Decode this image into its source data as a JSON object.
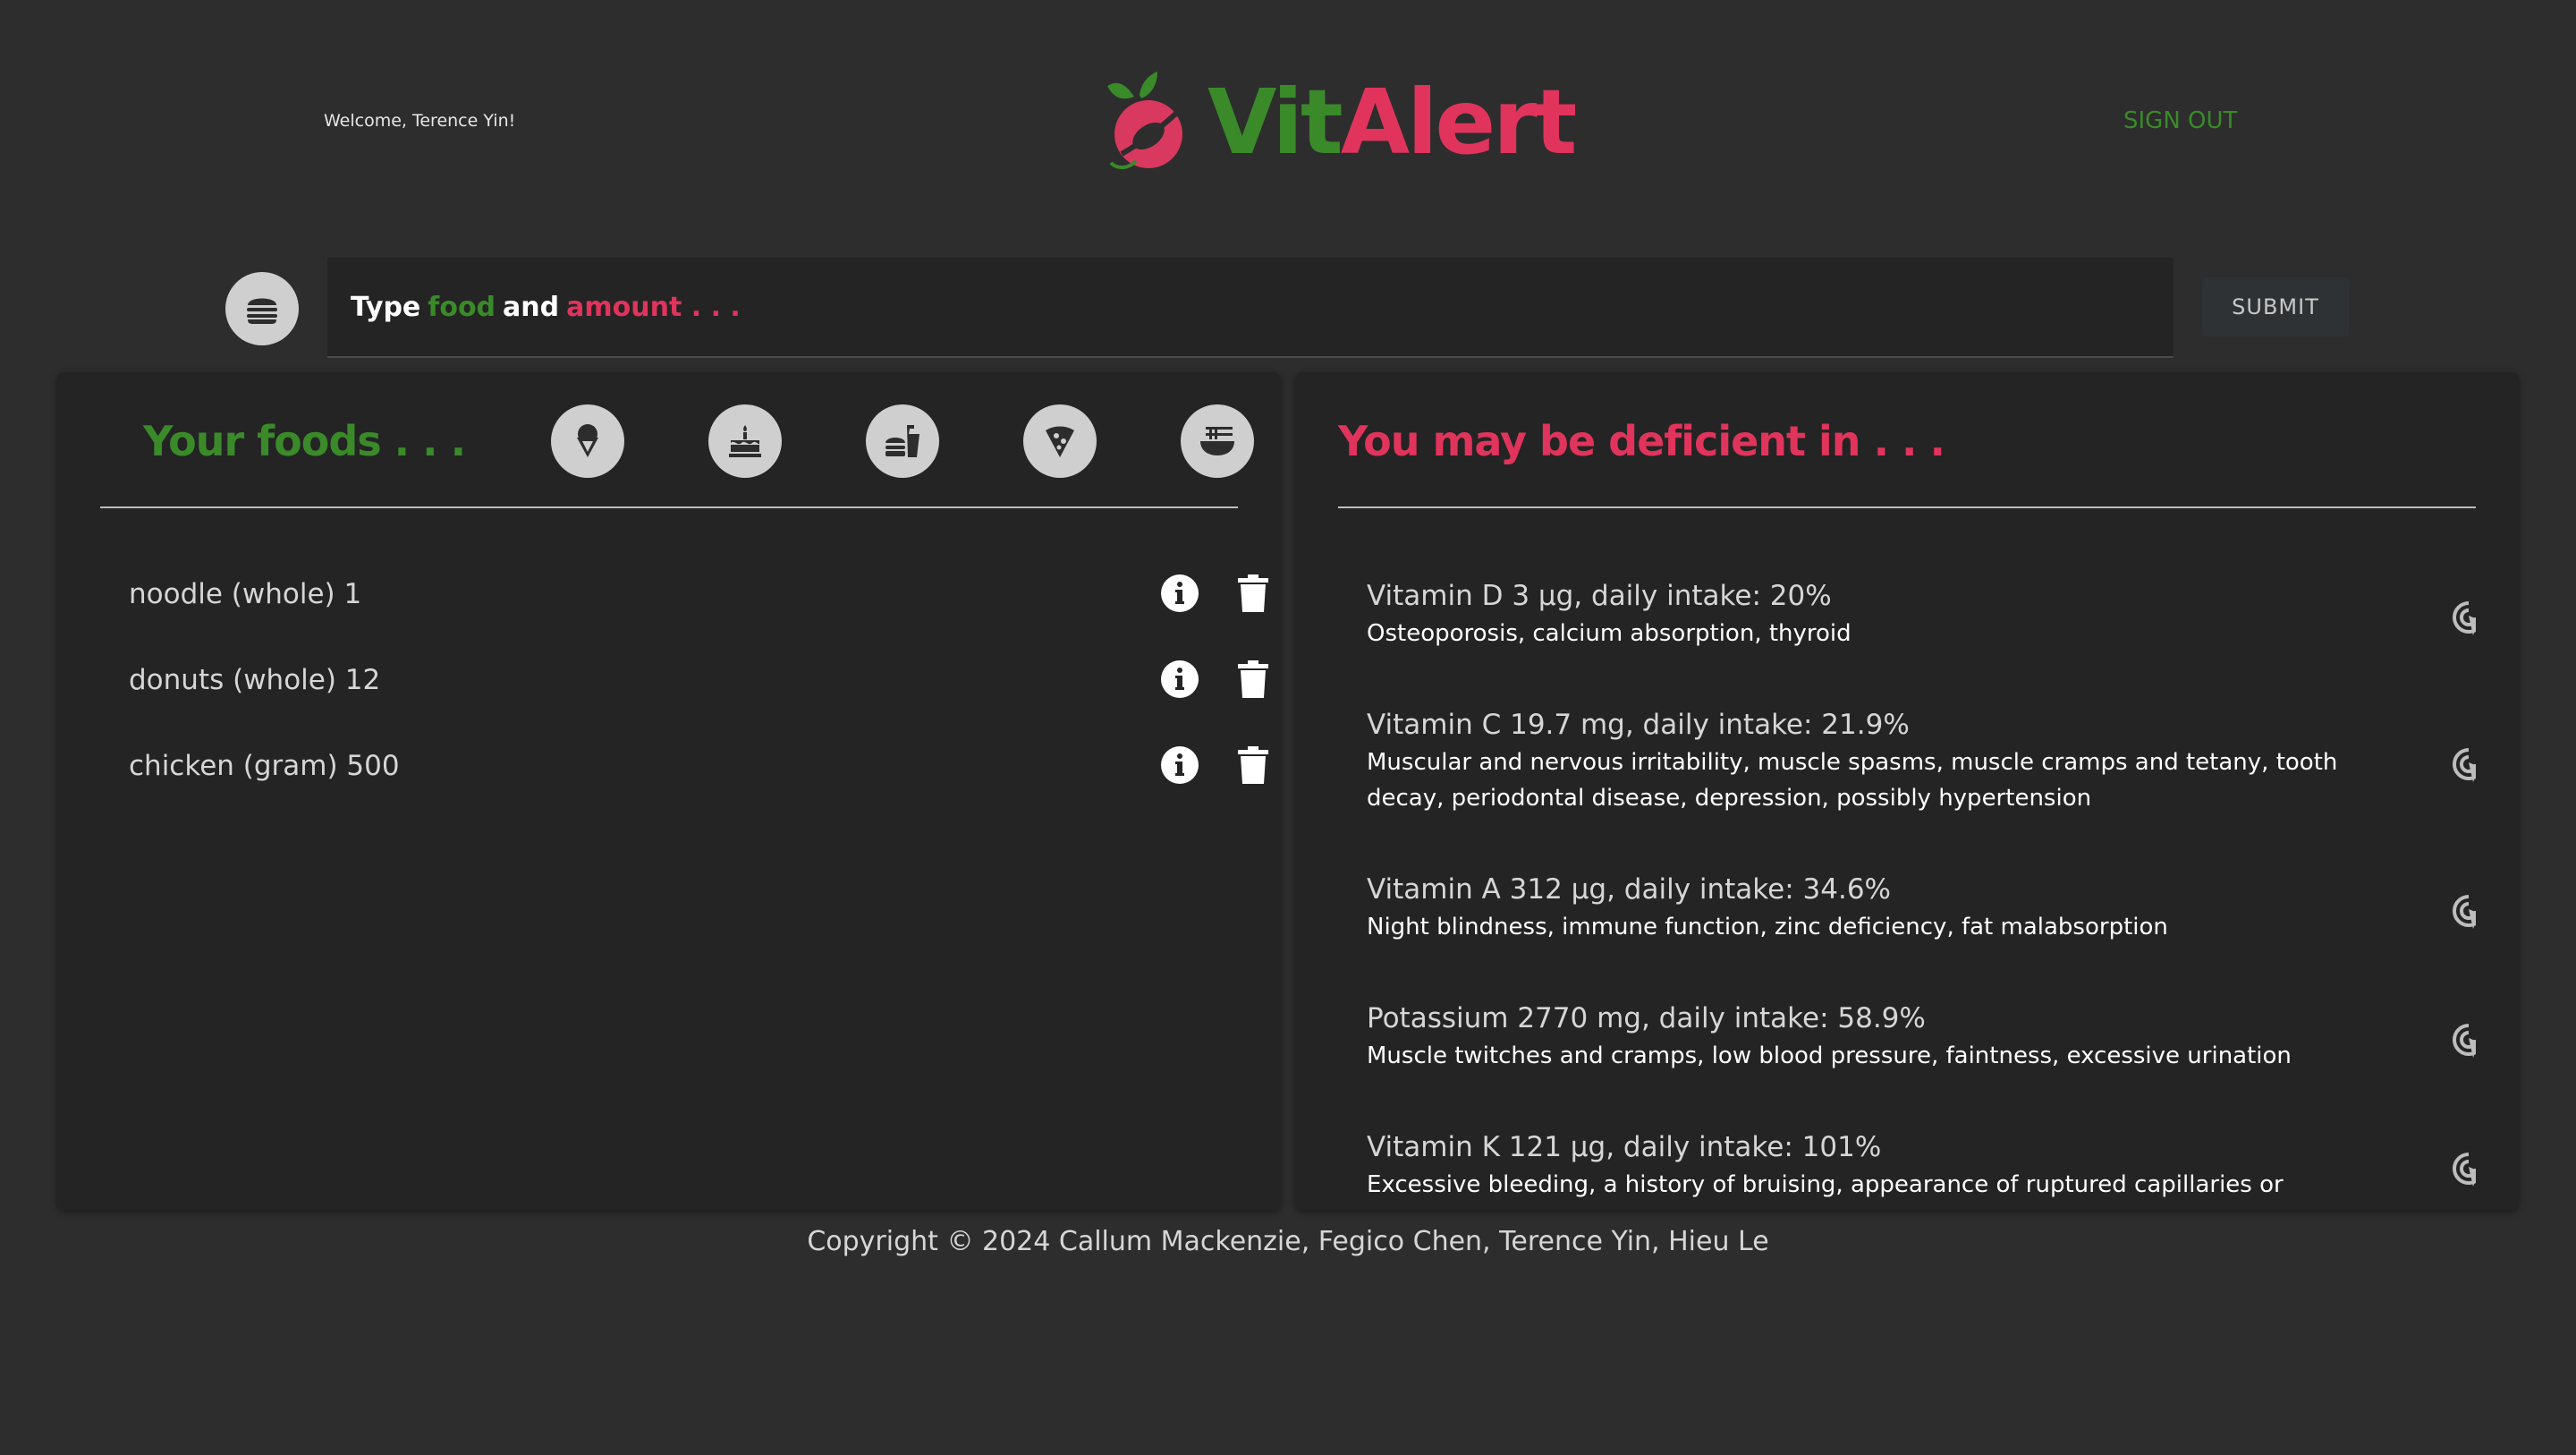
{
  "header": {
    "welcome": "Welcome, Terence Yin!",
    "logo_vit": "Vit",
    "logo_alert": "Alert",
    "sign_out": "SIGN OUT"
  },
  "search": {
    "prefix": "Type",
    "food": "food",
    "and": "and",
    "amount": "amount . . .",
    "submit": "SUBMIT"
  },
  "foods_panel": {
    "title": "Your foods . . .",
    "categories": [
      "ice-cream-icon",
      "cake-icon",
      "fast-food-icon",
      "pizza-icon",
      "noodle-bowl-icon"
    ],
    "items": [
      {
        "label": "noodle (whole) 1"
      },
      {
        "label": "donuts (whole) 12"
      },
      {
        "label": "chicken (gram) 500"
      }
    ]
  },
  "deficiency_panel": {
    "title": "You may be deficient in . . .",
    "items": [
      {
        "title": "Vitamin D 3 µg, daily intake: 20%",
        "desc": "Osteoporosis, calcium absorption, thyroid"
      },
      {
        "title": "Vitamin C 19.7 mg, daily intake: 21.9%",
        "desc": "Muscular and nervous irritability, muscle spasms, muscle cramps and tetany, tooth decay, periodontal disease, depression, possibly hypertension"
      },
      {
        "title": "Vitamin A 312 µg, daily intake: 34.6%",
        "desc": "Night blindness, immune function, zinc deficiency, fat malabsorption"
      },
      {
        "title": "Potassium 2770 mg, daily intake: 58.9%",
        "desc": "Muscle twitches and cramps, low blood pressure, faintness, excessive urination"
      },
      {
        "title": "Vitamin K 121 µg, daily intake: 101%",
        "desc": "Excessive bleeding, a history of bruising, appearance of ruptured capillaries or"
      }
    ]
  },
  "footer": {
    "copyright": "Copyright © 2024 Callum Mackenzie, Fegico Chen, Terence Yin, Hieu Le"
  },
  "colors": {
    "background": "#2d2d2d",
    "panel": "#242424",
    "green": "#3a8a2a",
    "red": "#e0345c"
  }
}
